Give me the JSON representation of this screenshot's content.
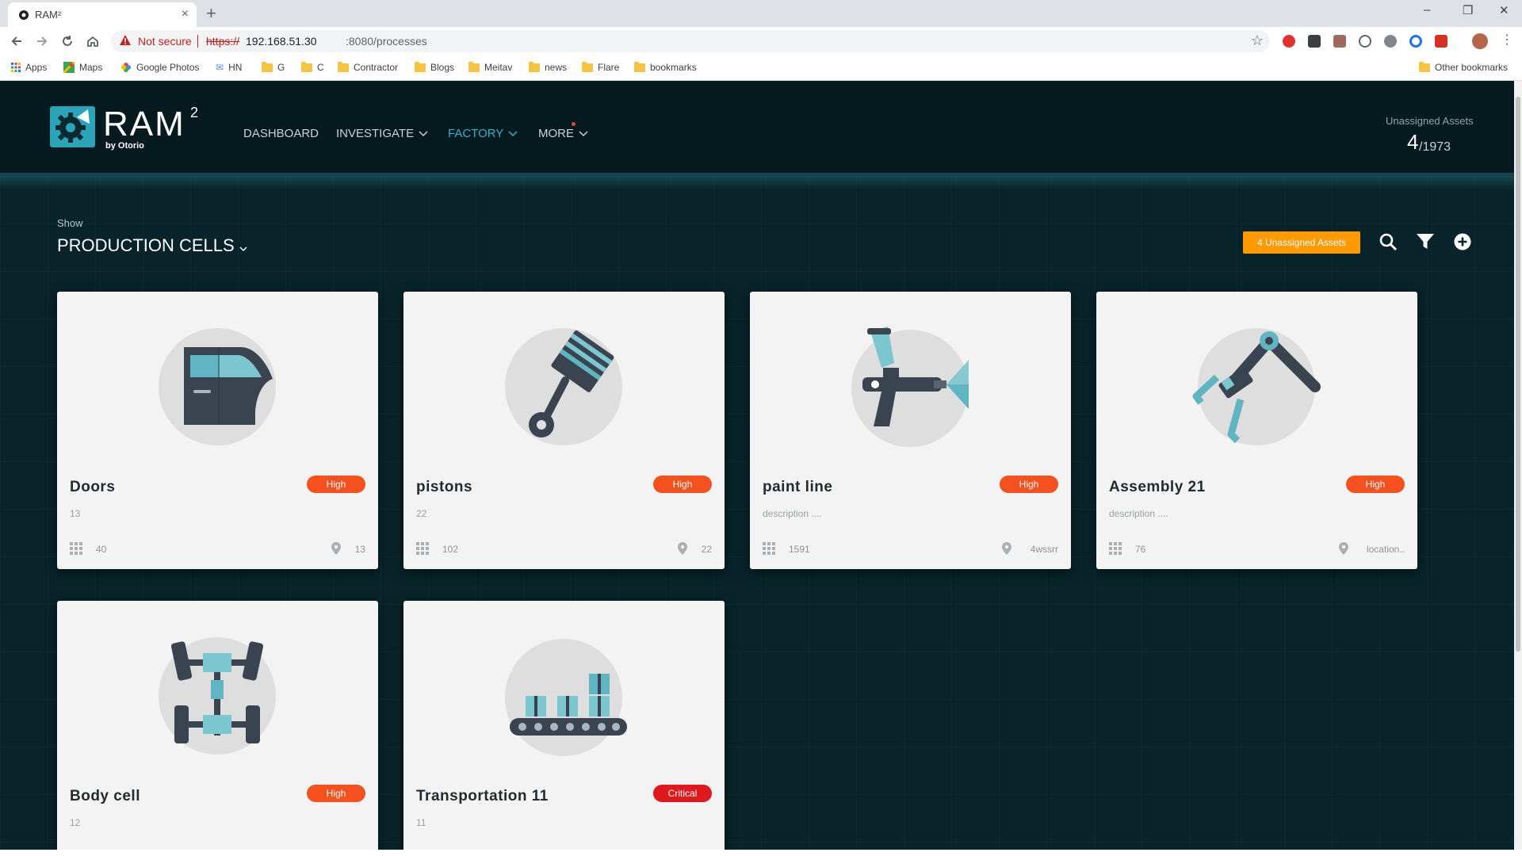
{
  "browser": {
    "tab_title": "RAM²",
    "tab_close": "×",
    "new_tab": "+",
    "window_controls": [
      "–",
      "❐",
      "✕"
    ],
    "security_label": "Not secure",
    "url_scheme": "https://",
    "url_host": "192.168.51.30",
    "url_path": ":8080/processes",
    "bookmarks": [
      "Apps",
      "Maps",
      "Google Photos",
      "HN",
      "G",
      "C",
      "Contractor",
      "Blogs",
      "Meitav",
      "news",
      "Flare",
      "bookmarks"
    ],
    "other_bookmarks": "Other bookmarks"
  },
  "app": {
    "logo_text": "RAM",
    "logo_sup": "2",
    "logo_by": "by Otorio",
    "nav": [
      {
        "label": "DASHBOARD",
        "dropdown": false,
        "active": false
      },
      {
        "label": "INVESTIGATE",
        "dropdown": true,
        "active": false
      },
      {
        "label": "FACTORY",
        "dropdown": true,
        "active": true
      },
      {
        "label": "MORE",
        "dropdown": true,
        "active": false,
        "notification": true
      }
    ],
    "unassigned_label": "Unassigned Assets",
    "unassigned_count": "4",
    "unassigned_total": "/1973",
    "show_label": "Show",
    "show_value": "PRODUCTION CELLS",
    "unassigned_button": "4 Unassigned Assets",
    "colors": {
      "header_bg": "#051a1f",
      "page_bg": "#082329",
      "accent": "#2ab7cb",
      "orange": "#ff9a00",
      "high": "#f4511e",
      "critical": "#e0191c"
    }
  },
  "cards": [
    {
      "title": "Doors",
      "desc": "13",
      "risk": "High",
      "risk_level": "high",
      "assets": "40",
      "location": "13",
      "art": "car-door-icon"
    },
    {
      "title": "pistons",
      "desc": "22",
      "risk": "High",
      "risk_level": "high",
      "assets": "102",
      "location": "22",
      "art": "piston-icon"
    },
    {
      "title": "paint line",
      "desc": "description ....",
      "risk": "High",
      "risk_level": "high",
      "assets": "1591",
      "location": "4wssrr",
      "art": "spray-gun-icon"
    },
    {
      "title": "Assembly 21",
      "desc": "description ....",
      "risk": "High",
      "risk_level": "high",
      "assets": "76",
      "location": "location..",
      "art": "robot-arm-icon"
    },
    {
      "title": "Body cell",
      "desc": "12",
      "risk": "High",
      "risk_level": "high",
      "assets": "",
      "location": "",
      "art": "chassis-icon"
    },
    {
      "title": "Transportation 11",
      "desc": "11",
      "risk": "Critical",
      "risk_level": "critical",
      "assets": "",
      "location": "",
      "art": "conveyor-icon"
    }
  ]
}
